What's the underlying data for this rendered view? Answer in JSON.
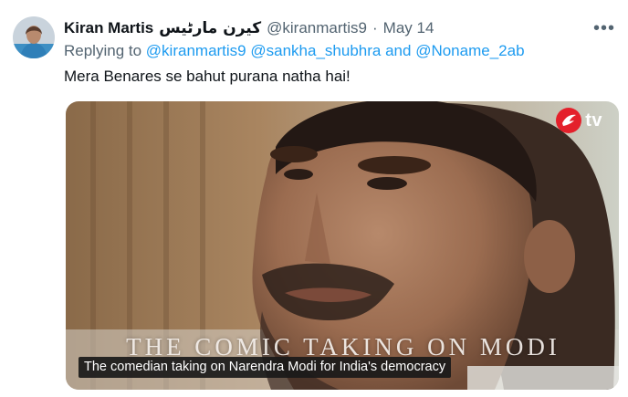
{
  "author": {
    "name": "Kiran Martis",
    "name_urdu": "کیرن مارٹیس",
    "handle": "@kiranmartis9",
    "separator": "·",
    "date": "May 14"
  },
  "more_icon": "more-horizontal-icon",
  "reply": {
    "prefix": "Replying to",
    "mentions": [
      "@kiranmartis9",
      "@sankha_shubhra"
    ],
    "conjunction": "and",
    "last_mention": "@Noname_2ab"
  },
  "tweet_text": "Mera Benares se bahut purana natha hai!",
  "media": {
    "headline": "THE COMIC TAKING ON MODI",
    "caption": "The comedian taking on Narendra Modi for India's democracy",
    "logo_text": "tv",
    "logo_icon": "tv-channel-logo-icon"
  },
  "colors": {
    "text_primary": "#0f1419",
    "text_secondary": "#536471",
    "link": "#1d9bf0",
    "logo_red": "#e4202b"
  }
}
